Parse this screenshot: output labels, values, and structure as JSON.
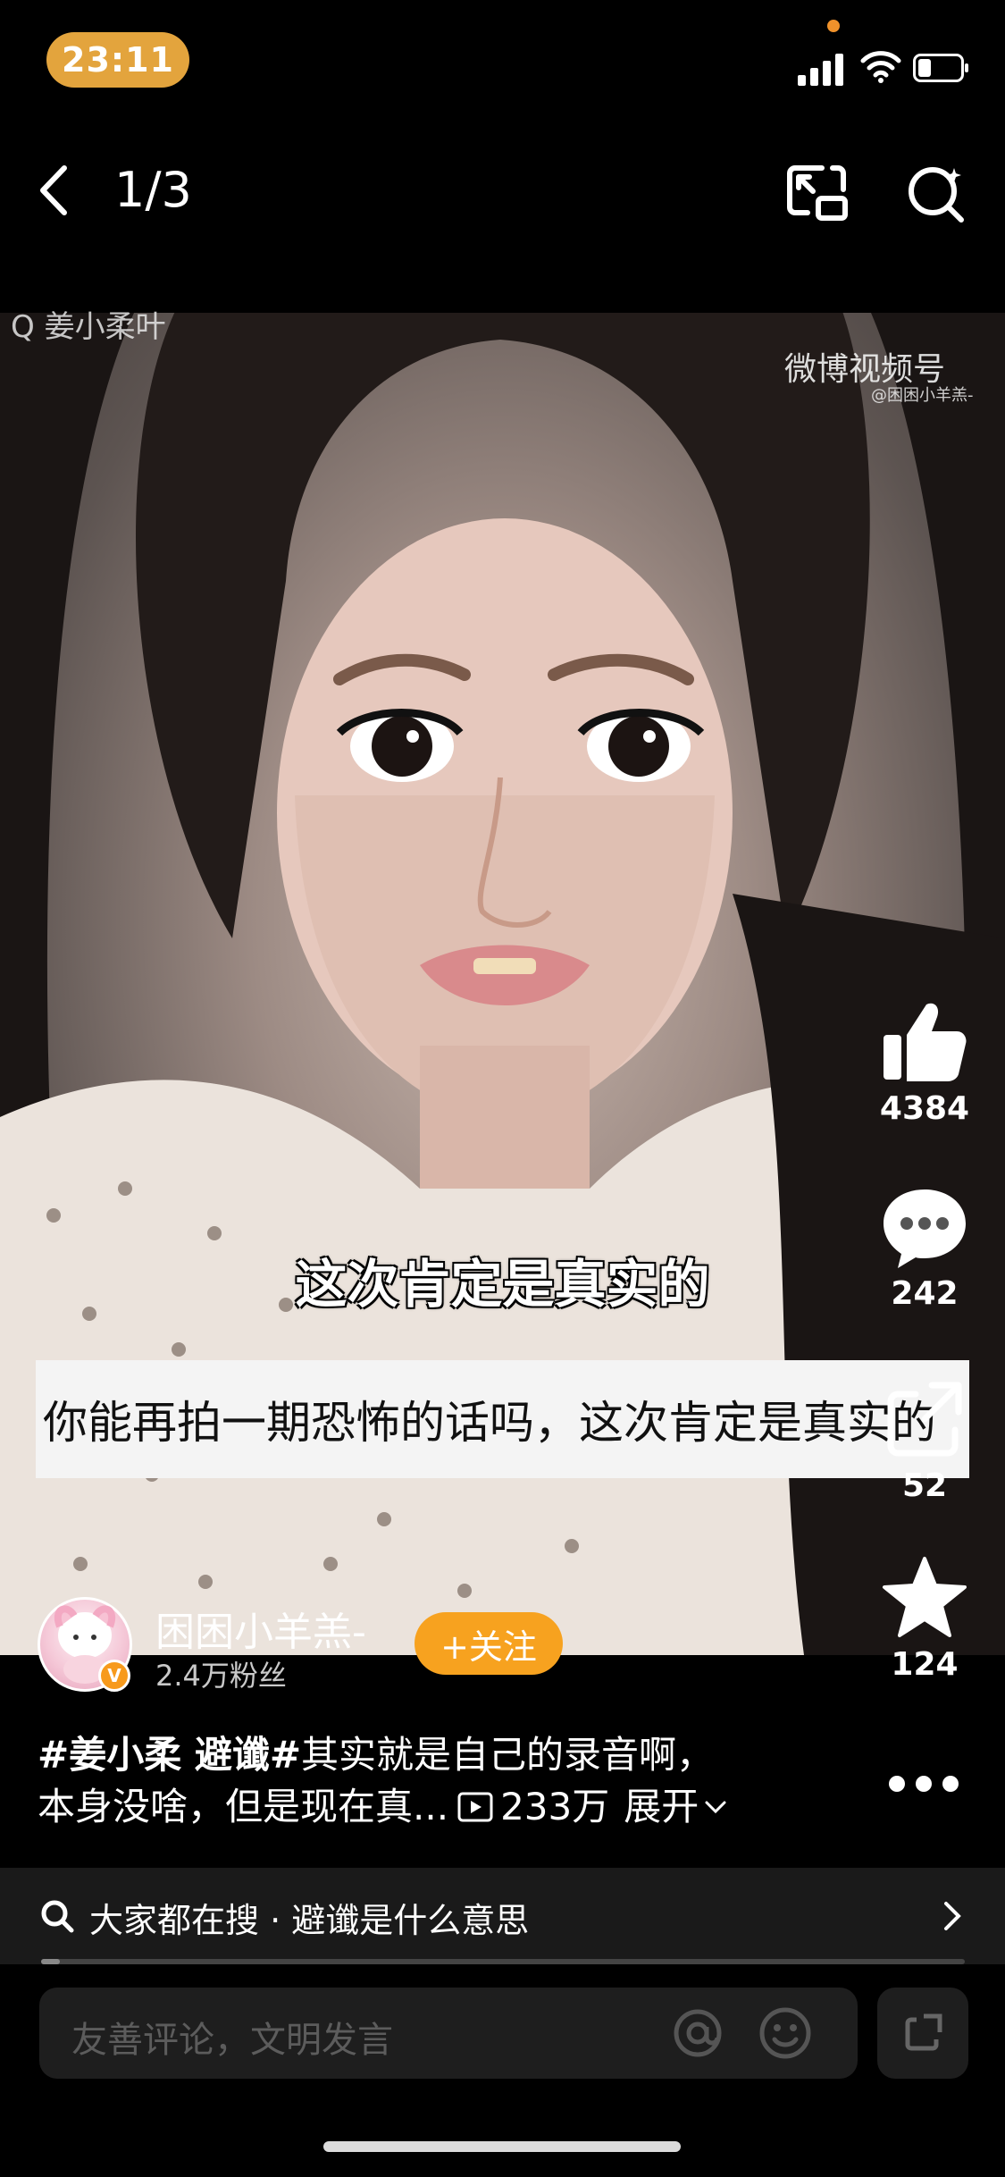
{
  "status_bar": {
    "time": "23:11"
  },
  "nav": {
    "page_counter": "1/3"
  },
  "video": {
    "watermark_top": "Q 姜小柔叶",
    "platform_watermark": "微博视频号",
    "platform_watermark_sub": "@困困小羊羔-",
    "subtitle_top": "这次肯定是真实的",
    "subtitle_band": "你能再拍一期恐怖的话吗，这次肯定是真实的"
  },
  "actions": {
    "likes": "4384",
    "comments": "242",
    "shares": "52",
    "favorites": "124"
  },
  "author": {
    "name": "困困小羊羔-",
    "fans": "2.4万粉丝",
    "follow_label": "+关注"
  },
  "caption": {
    "hashtag": "#姜小柔 避谶#",
    "line1_rest": "其实就是自己的录音啊，",
    "line2": "本身没啥，但是现在真...",
    "views": "233万",
    "expand": "展开"
  },
  "hot_search": {
    "text": "大家都在搜 · 避谶是什么意思",
    "progress": 0.02
  },
  "comment_box": {
    "placeholder": "友善评论，文明发言"
  },
  "colors": {
    "accent": "#f7a21f",
    "time_pill": "#e3a43d",
    "background": "#000000"
  },
  "icons": [
    "back-arrow-icon",
    "pip-icon",
    "search-icon",
    "like-icon",
    "comment-icon",
    "share-icon",
    "star-icon",
    "more-icon",
    "play-icon",
    "at-icon",
    "emoji-icon",
    "expand-icon"
  ]
}
